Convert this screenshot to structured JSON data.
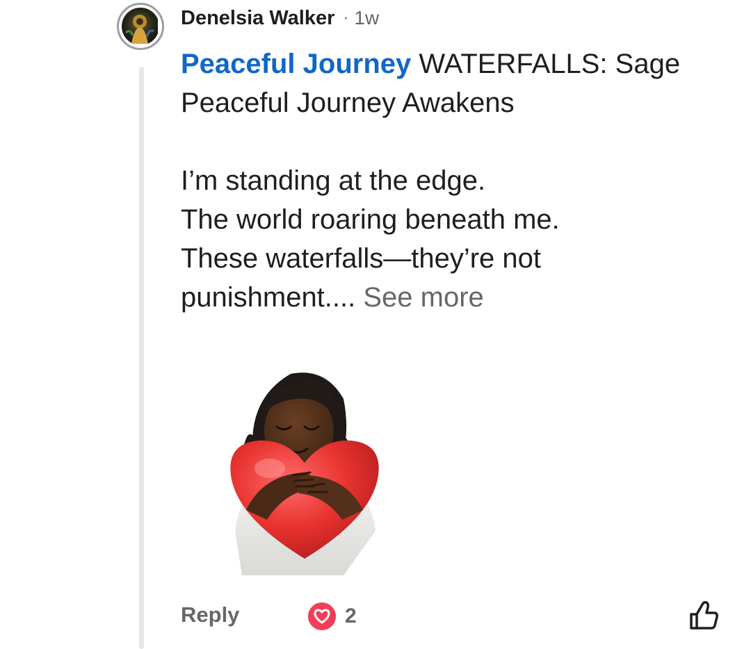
{
  "comment": {
    "author": "Denelsia Walker",
    "separator": "·",
    "time": "1w",
    "mention": "Peaceful Journey",
    "title_rest": " WATERFALLS: Sage Peaceful Journey Awakens",
    "lines": [
      "I’m standing at the edge.",
      "The world roaring beneath me.",
      "These waterfalls—they’re not",
      "punishment...."
    ],
    "see_more": " See more",
    "sticker_icon": "hug-heart-sticker"
  },
  "actions": {
    "reply_label": "Reply",
    "reaction_icon": "love-reaction-icon",
    "reaction_count": "2",
    "like_icon": "thumbs-up-icon"
  },
  "colors": {
    "mention": "#1167c6",
    "secondary_text": "#65676b",
    "love": "#f33e58",
    "thread_line": "#e4e6eb"
  }
}
